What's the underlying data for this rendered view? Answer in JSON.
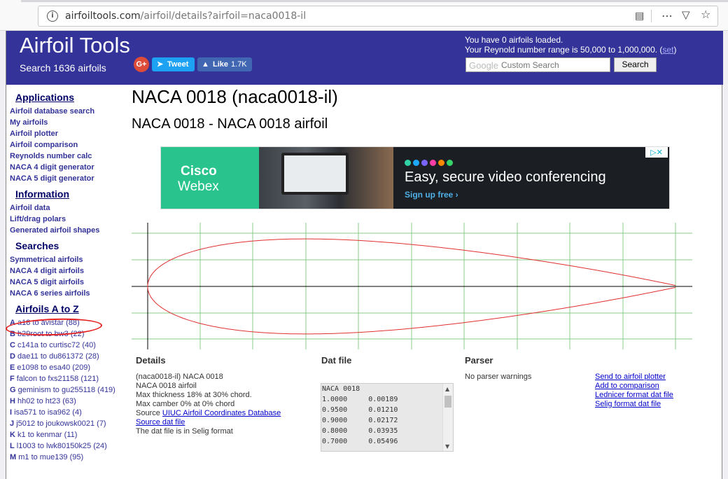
{
  "browser": {
    "url_host": "airfoiltools.com",
    "url_path": "/airfoil/details?airfoil=naca0018-il"
  },
  "header": {
    "title": "Airfoil Tools",
    "subtitle": "Search 1636 airfoils",
    "gplus": "G+",
    "tweet": "Tweet",
    "like": "Like",
    "like_count": "1.7K",
    "loaded_line1": "You have 0 airfoils loaded.",
    "loaded_line2": "Your Reynold number range is 50,000 to 1,000,000. (",
    "loaded_set": "set",
    "loaded_close": ")",
    "search_google": "Google",
    "search_placeholder": "Custom Search",
    "search_button": "Search"
  },
  "sidebar": {
    "applications_title": "Applications",
    "applications": [
      "Airfoil database search",
      "My airfoils",
      "Airfoil plotter",
      "Airfoil comparison",
      "Reynolds number calc",
      "NACA 4 digit generator",
      "NACA 5 digit generator"
    ],
    "information_title": "Information",
    "information": [
      "Airfoil data",
      "Lift/drag polars",
      "Generated airfoil shapes"
    ],
    "searches_title": "Searches",
    "searches": [
      "Symmetrical airfoils",
      "NACA 4 digit airfoils",
      "NACA 5 digit airfoils",
      "NACA 6 series airfoils"
    ],
    "az_title": "Airfoils A to Z",
    "az": [
      {
        "letter": "A",
        "text": "a18 to avistar (88)"
      },
      {
        "letter": "B",
        "text": "b29root to bw3 (22)"
      },
      {
        "letter": "C",
        "text": "c141a to curtisc72 (40)"
      },
      {
        "letter": "D",
        "text": "dae11 to du861372 (28)"
      },
      {
        "letter": "E",
        "text": "e1098 to esa40 (209)"
      },
      {
        "letter": "F",
        "text": "falcon to fxs21158 (121)"
      },
      {
        "letter": "G",
        "text": "geminism to gu255118 (419)"
      },
      {
        "letter": "H",
        "text": "hh02 to ht23 (63)"
      },
      {
        "letter": "I",
        "text": "isa571 to isa962 (4)"
      },
      {
        "letter": "J",
        "text": "j5012 to joukowsk0021 (7)"
      },
      {
        "letter": "K",
        "text": "k1 to kenmar (11)"
      },
      {
        "letter": "L",
        "text": "l1003 to lwk80150k25 (24)"
      },
      {
        "letter": "M",
        "text": "m1 to mue139 (95)"
      }
    ]
  },
  "main": {
    "title": "NACA 0018 (naca0018-il)",
    "subtitle": "NACA 0018 - NACA 0018 airfoil"
  },
  "ad": {
    "brand1": "Cisco",
    "brand2": "Webex",
    "headline": "Easy, secure video conferencing",
    "cta": "Sign up free",
    "dot_colors": [
      "#2fd1a5",
      "#1ea8ff",
      "#7b63ff",
      "#ff3ea5",
      "#ff8a00",
      "#38d26b"
    ]
  },
  "airfoil_plot": {
    "thickness": 0.18,
    "line_color": "#e03030",
    "grid_color": "#88cc88"
  },
  "details": {
    "title": "Details",
    "lines": [
      "(naca0018-il) NACA 0018",
      "NACA 0018 airfoil",
      "Max thickness 18% at 30% chord.",
      "Max camber 0% at 0% chord"
    ],
    "source_prefix": "Source ",
    "source_link": "UIUC Airfoil Coordinates Database",
    "source_dat": "Source dat file",
    "selig_note": "The dat file is in Selig format"
  },
  "datfile": {
    "title": "Dat file",
    "lines": [
      "NACA 0018",
      "1.0000     0.00189",
      "0.9500     0.01210",
      "0.9000     0.02172",
      "0.8000     0.03935",
      "0.7000     0.05496"
    ]
  },
  "parser": {
    "title": "Parser",
    "text": "No parser warnings",
    "links": [
      "Send to airfoil plotter",
      "Add to comparison",
      "Lednicer format dat file",
      "Selig format dat file"
    ]
  }
}
